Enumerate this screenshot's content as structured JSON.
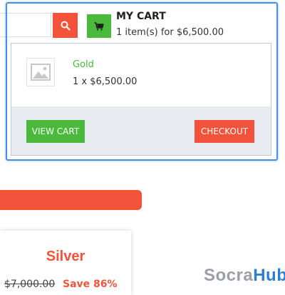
{
  "header": {
    "search_icon": "search-icon",
    "cart_icon": "cart-icon",
    "cart_title": "MY CART",
    "cart_summary": "1 item(s) for $6,500.00"
  },
  "cart": {
    "items": [
      {
        "name": "Gold",
        "qty_price": "1 x $6,500.00",
        "thumbnail_icon": "image-placeholder-icon"
      }
    ],
    "view_cart_label": "VIEW CART",
    "checkout_label": "CHECKOUT"
  },
  "product": {
    "name": "Silver",
    "old_price": "$7,000.00",
    "save_text": "Save 86%"
  },
  "watermark": {
    "part1": "Socra",
    "part2": "Hub"
  },
  "colors": {
    "accent_orange": "#f4533b",
    "accent_green": "#4ab93c",
    "focus_blue": "#4a90e2",
    "footer_bg": "#e8ebef"
  }
}
